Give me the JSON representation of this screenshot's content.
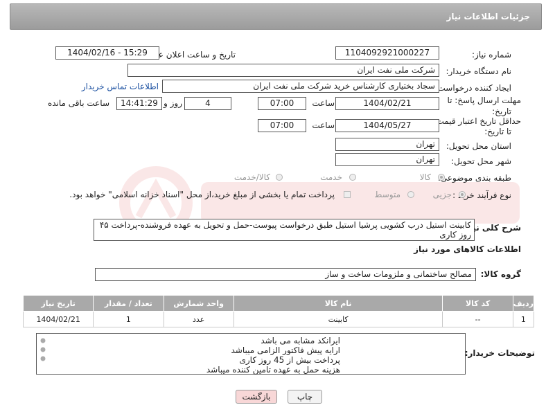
{
  "header": {
    "title": "جزئیات اطلاعات نیاز"
  },
  "form": {
    "need_number_label": "شماره نیاز:",
    "need_number": "1104092921000227",
    "announce_label": "تاریخ و ساعت اعلان عمومی:",
    "announce_value": "1404/02/16 - 15:29",
    "buyer_org_label": "نام دستگاه خریدار:",
    "buyer_org": "شرکت ملی نفت ایران",
    "creator_label": "ایجاد کننده درخواست:",
    "creator": "سجاد بختیاری کارشناس خرید شرکت ملی نفت ایران",
    "contact_link": "اطلاعات تماس خریدار",
    "deadline_label_1": "مهلت ارسال پاسخ: تا",
    "deadline_label_2": "تاریخ:",
    "deadline_date": "1404/02/21",
    "time_label": "ساعت",
    "deadline_time": "07:00",
    "days_value": "4",
    "days_label": "روز و",
    "remaining_time": "14:41:29",
    "remaining_label": "ساعت باقی مانده",
    "validity_label_1": "حداقل تاریخ اعتبار قیمت:",
    "validity_label_2": "تا تاریخ:",
    "validity_date": "1404/05/27",
    "validity_time": "07:00",
    "province_label": "استان محل تحویل:",
    "province": "تهران",
    "city_label": "شهر محل تحویل:",
    "city": "تهران",
    "category_label": "طبقه بندی موضوعی:",
    "category_options": [
      "کالا",
      "خدمت",
      "کالا/خدمت"
    ],
    "process_label": "نوع فرآیند خرید :",
    "process_options": [
      "جزیی",
      "متوسط"
    ],
    "payment_note": "پرداخت تمام یا بخشی از مبلغ خرید،از محل \"اسناد خزانه اسلامی\" خواهد بود."
  },
  "summary": {
    "label": "شرح کلی نیاز:",
    "text": "کابینت استیل درب کشویی پرشیا استیل طبق درخواست پیوست-حمل و تحویل به عهده فروشنده-پرداخت ۴۵ روز کاری"
  },
  "goods_info": {
    "title": "اطلاعات کالاهای مورد نیاز"
  },
  "group": {
    "label": "گروه کالا:",
    "value": "مصالح ساختمانی و ملزومات ساخت و ساز"
  },
  "table": {
    "headers": [
      "ردیف",
      "کد کالا",
      "نام کالا",
      "واحد شمارش",
      "تعداد / مقدار",
      "تاریخ نیاز"
    ],
    "rows": [
      {
        "row": "1",
        "code": "--",
        "name": "کابینت",
        "unit": "عدد",
        "qty": "1",
        "date": "1404/02/21"
      }
    ]
  },
  "notes": {
    "label": "توضیحات خریدار:",
    "lines": [
      "ایرانکد مشابه می باشد",
      "ارایه پیش فاکتور الزامی میباشد",
      "پرداخت بیش از 45 روز کاری",
      "هزینه حمل به عهده تامین کننده میباشد"
    ]
  },
  "buttons": {
    "print": "چاپ",
    "back": "بازگشت"
  },
  "colors": {
    "header": "#a8a8a8",
    "table_header": "#a9a9a9",
    "link": "#1a4fa0",
    "back_button": "#f8d7d7"
  }
}
